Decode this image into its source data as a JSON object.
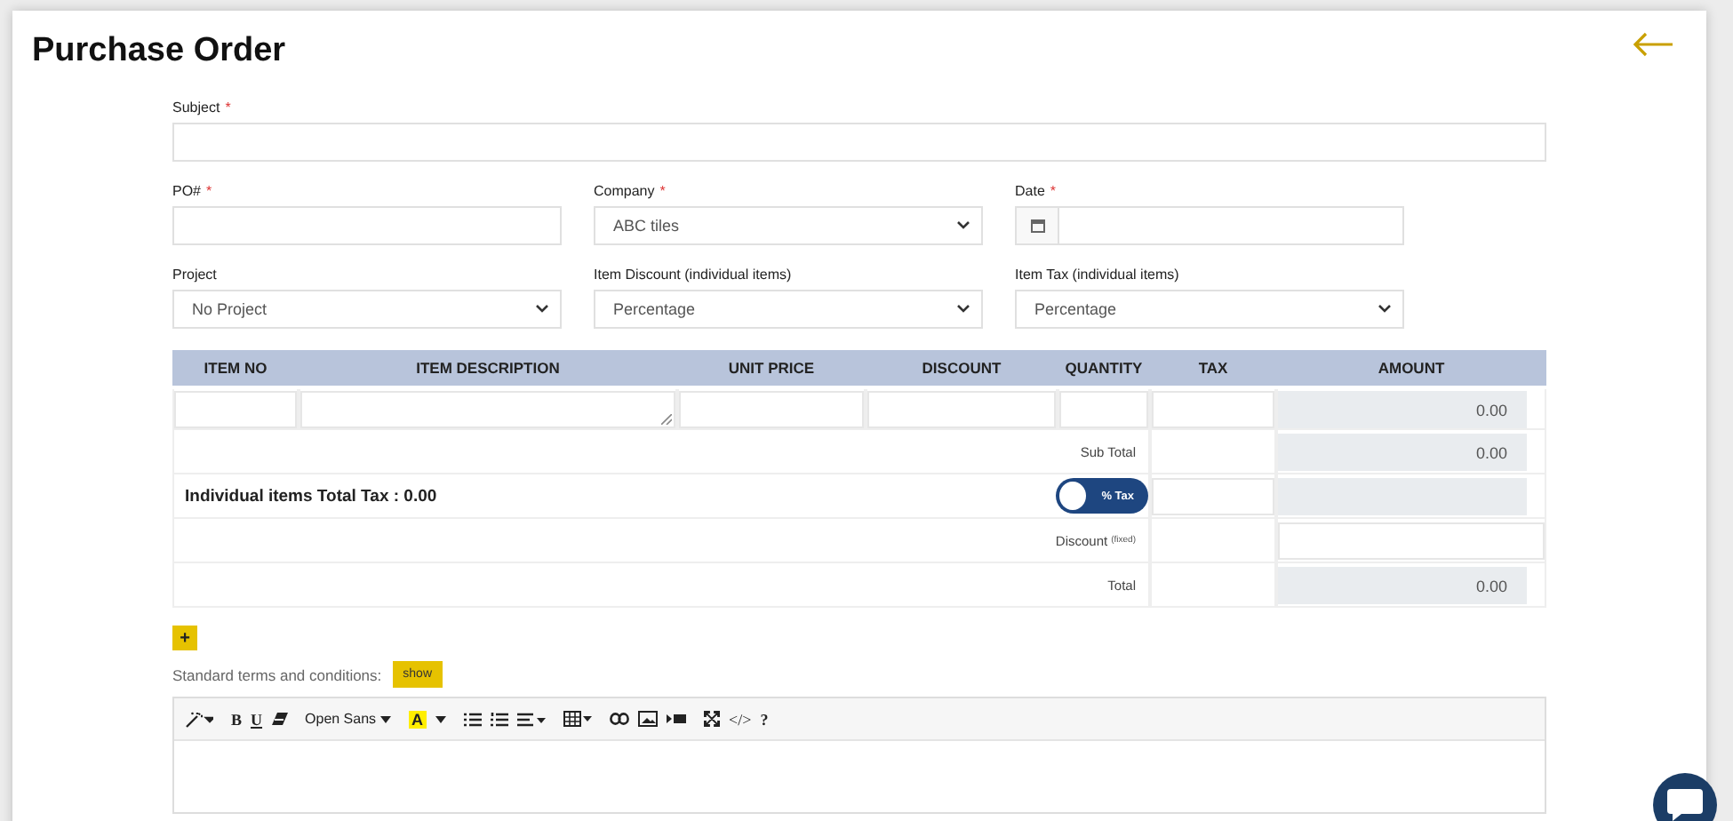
{
  "page": {
    "title": "Purchase Order"
  },
  "form_rows": [
    [
      {
        "label": "Subject",
        "required_mark": "*",
        "kind": "text",
        "wide": true
      }
    ],
    [
      {
        "label": "PO#",
        "required_mark": "*",
        "kind": "text"
      },
      {
        "label": "Company",
        "required_mark": "*",
        "kind": "select",
        "value": "ABC tiles"
      },
      {
        "label": "Date",
        "required_mark": "*",
        "kind": "date"
      }
    ],
    [
      {
        "label": "Project",
        "kind": "select",
        "value": "No Project"
      },
      {
        "label": "Item Discount (individual items)",
        "kind": "select",
        "value": "Percentage"
      },
      {
        "label": "Item Tax (individual items)",
        "kind": "select",
        "value": "Percentage"
      }
    ]
  ],
  "table": {
    "columns": [
      "ITEM NO",
      "ITEM DESCRIPTION",
      "UNIT PRICE",
      "DISCOUNT",
      "QUANTITY",
      "TAX",
      "AMOUNT"
    ],
    "item_row": {
      "amount": "0.00"
    },
    "sub_total": {
      "label": "Sub Total",
      "amount": "0.00"
    },
    "tax_row": {
      "label": "Individual items Total Tax : 0.00",
      "toggle": {
        "label": "% Tax",
        "on": false
      }
    },
    "discount": {
      "label": "Discount",
      "note": "(fixed)"
    },
    "total": {
      "label": "Total",
      "amount": "0.00"
    }
  },
  "add_button": "+",
  "terms": {
    "label": "Standard terms and conditions:",
    "button": "show"
  },
  "editor": {
    "bold": "B",
    "underline": "U",
    "font": "Open Sans",
    "highlight_letter": "A",
    "code": "</>",
    "help": "?"
  }
}
